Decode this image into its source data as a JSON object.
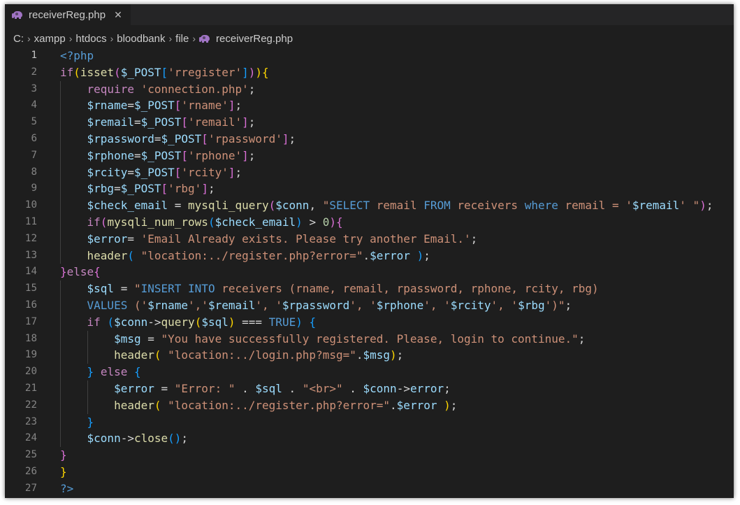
{
  "tab": {
    "icon": "php-elephant-icon",
    "label": "receiverReg.php",
    "close_glyph": "✕"
  },
  "breadcrumb": [
    "C:",
    "xampp",
    "htdocs",
    "bloodbank",
    "file",
    "receiverReg.php"
  ],
  "active_line": 1,
  "colors": {
    "keyword": "#c586c0",
    "php_tag": "#569cd6",
    "function": "#dcdcaa",
    "variable": "#9cdcfe",
    "string": "#ce9178",
    "number": "#b5cea8",
    "bracket_1": "#ffd700",
    "bracket_2": "#da70d6",
    "bracket_3": "#179fff"
  },
  "lines": [
    {
      "n": "1",
      "indent": 0,
      "tokens": [
        [
          "tag",
          "<?php"
        ]
      ]
    },
    {
      "n": "2",
      "indent": 0,
      "tokens": [
        [
          "kw",
          "if"
        ],
        [
          "b1",
          "("
        ],
        [
          "fn",
          "isset"
        ],
        [
          "b2",
          "("
        ],
        [
          "var",
          "$_POST"
        ],
        [
          "b3",
          "["
        ],
        [
          "str",
          "'rregister'"
        ],
        [
          "b3",
          "]"
        ],
        [
          "b2",
          ")"
        ],
        [
          "b1",
          ")"
        ],
        [
          "b1",
          "{"
        ]
      ]
    },
    {
      "n": "3",
      "indent": 1,
      "tokens": [
        [
          "kw",
          "require"
        ],
        [
          "op",
          " "
        ],
        [
          "str",
          "'connection.php'"
        ],
        [
          "op",
          ";"
        ]
      ]
    },
    {
      "n": "4",
      "indent": 1,
      "tokens": [
        [
          "var",
          "$rname"
        ],
        [
          "op",
          "="
        ],
        [
          "var",
          "$_POST"
        ],
        [
          "b2",
          "["
        ],
        [
          "str",
          "'rname'"
        ],
        [
          "b2",
          "]"
        ],
        [
          "op",
          ";"
        ]
      ]
    },
    {
      "n": "5",
      "indent": 1,
      "tokens": [
        [
          "var",
          "$remail"
        ],
        [
          "op",
          "="
        ],
        [
          "var",
          "$_POST"
        ],
        [
          "b2",
          "["
        ],
        [
          "str",
          "'remail'"
        ],
        [
          "b2",
          "]"
        ],
        [
          "op",
          ";"
        ]
      ]
    },
    {
      "n": "6",
      "indent": 1,
      "tokens": [
        [
          "var",
          "$rpassword"
        ],
        [
          "op",
          "="
        ],
        [
          "var",
          "$_POST"
        ],
        [
          "b2",
          "["
        ],
        [
          "str",
          "'rpassword'"
        ],
        [
          "b2",
          "]"
        ],
        [
          "op",
          ";"
        ]
      ]
    },
    {
      "n": "7",
      "indent": 1,
      "tokens": [
        [
          "var",
          "$rphone"
        ],
        [
          "op",
          "="
        ],
        [
          "var",
          "$_POST"
        ],
        [
          "b2",
          "["
        ],
        [
          "str",
          "'rphone'"
        ],
        [
          "b2",
          "]"
        ],
        [
          "op",
          ";"
        ]
      ]
    },
    {
      "n": "8",
      "indent": 1,
      "tokens": [
        [
          "var",
          "$rcity"
        ],
        [
          "op",
          "="
        ],
        [
          "var",
          "$_POST"
        ],
        [
          "b2",
          "["
        ],
        [
          "str",
          "'rcity'"
        ],
        [
          "b2",
          "]"
        ],
        [
          "op",
          ";"
        ]
      ]
    },
    {
      "n": "9",
      "indent": 1,
      "tokens": [
        [
          "var",
          "$rbg"
        ],
        [
          "op",
          "="
        ],
        [
          "var",
          "$_POST"
        ],
        [
          "b2",
          "["
        ],
        [
          "str",
          "'rbg'"
        ],
        [
          "b2",
          "]"
        ],
        [
          "op",
          ";"
        ]
      ]
    },
    {
      "n": "10",
      "indent": 1,
      "tokens": [
        [
          "var",
          "$check_email"
        ],
        [
          "op",
          " = "
        ],
        [
          "fn",
          "mysqli_query"
        ],
        [
          "b2",
          "("
        ],
        [
          "var",
          "$conn"
        ],
        [
          "op",
          ", "
        ],
        [
          "str",
          "\""
        ],
        [
          "sql",
          "SELECT"
        ],
        [
          "str",
          " remail "
        ],
        [
          "sql",
          "FROM"
        ],
        [
          "str",
          " receivers "
        ],
        [
          "sql",
          "where"
        ],
        [
          "str",
          " remail = '"
        ],
        [
          "var",
          "$remail"
        ],
        [
          "str",
          "' \""
        ],
        [
          "b2",
          ")"
        ],
        [
          "op",
          ";"
        ]
      ]
    },
    {
      "n": "11",
      "indent": 1,
      "tokens": [
        [
          "kw",
          "if"
        ],
        [
          "b2",
          "("
        ],
        [
          "fn",
          "mysqli_num_rows"
        ],
        [
          "b3",
          "("
        ],
        [
          "var",
          "$check_email"
        ],
        [
          "b3",
          ")"
        ],
        [
          "op",
          " > "
        ],
        [
          "num",
          "0"
        ],
        [
          "b2",
          ")"
        ],
        [
          "b2",
          "{"
        ]
      ]
    },
    {
      "n": "12",
      "indent": 1,
      "tokens": [
        [
          "var",
          "$error"
        ],
        [
          "op",
          "= "
        ],
        [
          "str",
          "'Email Already exists. Please try another Email.'"
        ],
        [
          "op",
          ";"
        ]
      ]
    },
    {
      "n": "13",
      "indent": 1,
      "tokens": [
        [
          "fn",
          "header"
        ],
        [
          "b3",
          "("
        ],
        [
          "op",
          " "
        ],
        [
          "str",
          "\"location:../register.php?error=\""
        ],
        [
          "op",
          "."
        ],
        [
          "var",
          "$error"
        ],
        [
          "op",
          " "
        ],
        [
          "b3",
          ")"
        ],
        [
          "op",
          ";"
        ]
      ]
    },
    {
      "n": "14",
      "indent": 0,
      "tokens": [
        [
          "b2",
          "}"
        ],
        [
          "kw",
          "else"
        ],
        [
          "b2",
          "{"
        ]
      ]
    },
    {
      "n": "15",
      "indent": 1,
      "tokens": [
        [
          "var",
          "$sql"
        ],
        [
          "op",
          " = "
        ],
        [
          "str",
          "\""
        ],
        [
          "sql",
          "INSERT INTO"
        ],
        [
          "str",
          " receivers (rname, remail, rpassword, rphone, rcity, rbg)"
        ]
      ]
    },
    {
      "n": "16",
      "indent": 1,
      "tokens": [
        [
          "sql",
          "VALUES"
        ],
        [
          "str",
          " ('"
        ],
        [
          "var",
          "$rname"
        ],
        [
          "str",
          "','"
        ],
        [
          "var",
          "$remail"
        ],
        [
          "str",
          "', '"
        ],
        [
          "var",
          "$rpassword"
        ],
        [
          "str",
          "', '"
        ],
        [
          "var",
          "$rphone"
        ],
        [
          "str",
          "', '"
        ],
        [
          "var",
          "$rcity"
        ],
        [
          "str",
          "', '"
        ],
        [
          "var",
          "$rbg"
        ],
        [
          "str",
          "')\""
        ],
        [
          "op",
          ";"
        ]
      ]
    },
    {
      "n": "17",
      "indent": 1,
      "tokens": [
        [
          "kw",
          "if"
        ],
        [
          "op",
          " "
        ],
        [
          "b3",
          "("
        ],
        [
          "var",
          "$conn"
        ],
        [
          "op",
          "->"
        ],
        [
          "fn",
          "query"
        ],
        [
          "b1",
          "("
        ],
        [
          "var",
          "$sql"
        ],
        [
          "b1",
          ")"
        ],
        [
          "op",
          " === "
        ],
        [
          "tag",
          "TRUE"
        ],
        [
          "b3",
          ")"
        ],
        [
          "op",
          " "
        ],
        [
          "b3",
          "{"
        ]
      ]
    },
    {
      "n": "18",
      "indent": 2,
      "tokens": [
        [
          "var",
          "$msg"
        ],
        [
          "op",
          " = "
        ],
        [
          "str",
          "\"You have successfully registered. Please, login to continue.\""
        ],
        [
          "op",
          ";"
        ]
      ]
    },
    {
      "n": "19",
      "indent": 2,
      "tokens": [
        [
          "fn",
          "header"
        ],
        [
          "b1",
          "("
        ],
        [
          "op",
          " "
        ],
        [
          "str",
          "\"location:../login.php?msg=\""
        ],
        [
          "op",
          "."
        ],
        [
          "var",
          "$msg"
        ],
        [
          "b1",
          ")"
        ],
        [
          "op",
          ";"
        ]
      ]
    },
    {
      "n": "20",
      "indent": 1,
      "tokens": [
        [
          "b3",
          "}"
        ],
        [
          "op",
          " "
        ],
        [
          "kw",
          "else"
        ],
        [
          "op",
          " "
        ],
        [
          "b3",
          "{"
        ]
      ]
    },
    {
      "n": "21",
      "indent": 2,
      "tokens": [
        [
          "var",
          "$error"
        ],
        [
          "op",
          " = "
        ],
        [
          "str",
          "\"Error: \""
        ],
        [
          "op",
          " . "
        ],
        [
          "var",
          "$sql"
        ],
        [
          "op",
          " . "
        ],
        [
          "str",
          "\"<br>\""
        ],
        [
          "op",
          " . "
        ],
        [
          "var",
          "$conn"
        ],
        [
          "op",
          "->"
        ],
        [
          "var",
          "error"
        ],
        [
          "op",
          ";"
        ]
      ]
    },
    {
      "n": "22",
      "indent": 2,
      "tokens": [
        [
          "fn",
          "header"
        ],
        [
          "b1",
          "("
        ],
        [
          "op",
          " "
        ],
        [
          "str",
          "\"location:../register.php?error=\""
        ],
        [
          "op",
          "."
        ],
        [
          "var",
          "$error"
        ],
        [
          "op",
          " "
        ],
        [
          "b1",
          ")"
        ],
        [
          "op",
          ";"
        ]
      ]
    },
    {
      "n": "23",
      "indent": 1,
      "tokens": [
        [
          "b3",
          "}"
        ]
      ]
    },
    {
      "n": "24",
      "indent": 1,
      "tokens": [
        [
          "var",
          "$conn"
        ],
        [
          "op",
          "->"
        ],
        [
          "fn",
          "close"
        ],
        [
          "b3",
          "("
        ],
        [
          "b3",
          ")"
        ],
        [
          "op",
          ";"
        ]
      ]
    },
    {
      "n": "25",
      "indent": 0,
      "tokens": [
        [
          "b2",
          "}"
        ]
      ]
    },
    {
      "n": "26",
      "indent": 0,
      "tokens": [
        [
          "b1",
          "}"
        ]
      ]
    },
    {
      "n": "27",
      "indent": 0,
      "tokens": [
        [
          "tag",
          "?>"
        ]
      ]
    }
  ]
}
